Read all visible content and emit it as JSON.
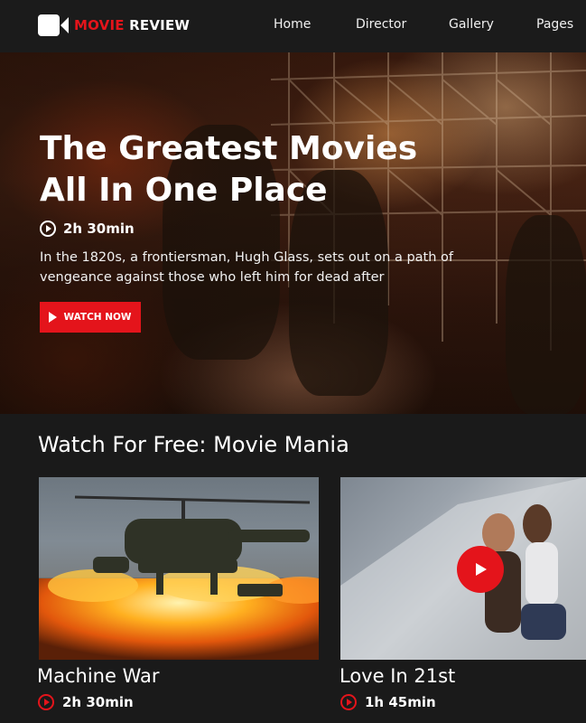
{
  "header": {
    "logo": {
      "brand_red": "MOVIE",
      "brand_white": "REVIEW",
      "icon": "video-camera-icon"
    },
    "nav": [
      "Home",
      "Director",
      "Gallery",
      "Pages"
    ]
  },
  "hero": {
    "title_line1": "The Greatest Movies",
    "title_line2": "All In One Place",
    "duration": "2h 30min",
    "description": "In the 1820s, a frontiersman, Hugh Glass, sets out on a path of vengeance against those who left him for dead after",
    "watch_button": "WATCH NOW"
  },
  "section": {
    "title": "Watch For Free: Movie Mania",
    "movies": [
      {
        "title": "Machine War",
        "duration": "2h 30min"
      },
      {
        "title": "Love In 21st",
        "duration": "1h 45min"
      }
    ]
  },
  "colors": {
    "accent": "#e4141b",
    "background": "#1a1a1a"
  }
}
